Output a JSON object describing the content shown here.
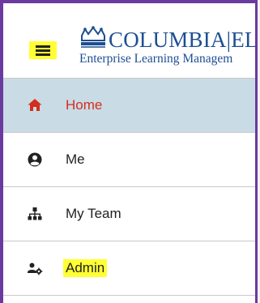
{
  "header": {
    "menu_icon": "hamburger-menu-icon",
    "logo_icon": "columbia-crown-icon",
    "brand_name": "COLUMBIA|EL",
    "brand_subtitle": "Enterprise Learning Managem"
  },
  "nav": {
    "items": [
      {
        "label": "Home",
        "icon": "home-icon",
        "active": true
      },
      {
        "label": "Me",
        "icon": "user-circle-icon",
        "active": false
      },
      {
        "label": "My Team",
        "icon": "org-chart-icon",
        "active": false
      },
      {
        "label": "Admin",
        "icon": "user-gear-icon",
        "active": false,
        "highlighted": true
      }
    ]
  },
  "colors": {
    "frame": "#6b3aa0",
    "active_bg": "#c9dbe5",
    "active_text": "#d32e1f",
    "highlight": "#ffff33",
    "brand": "#1d4f91"
  }
}
